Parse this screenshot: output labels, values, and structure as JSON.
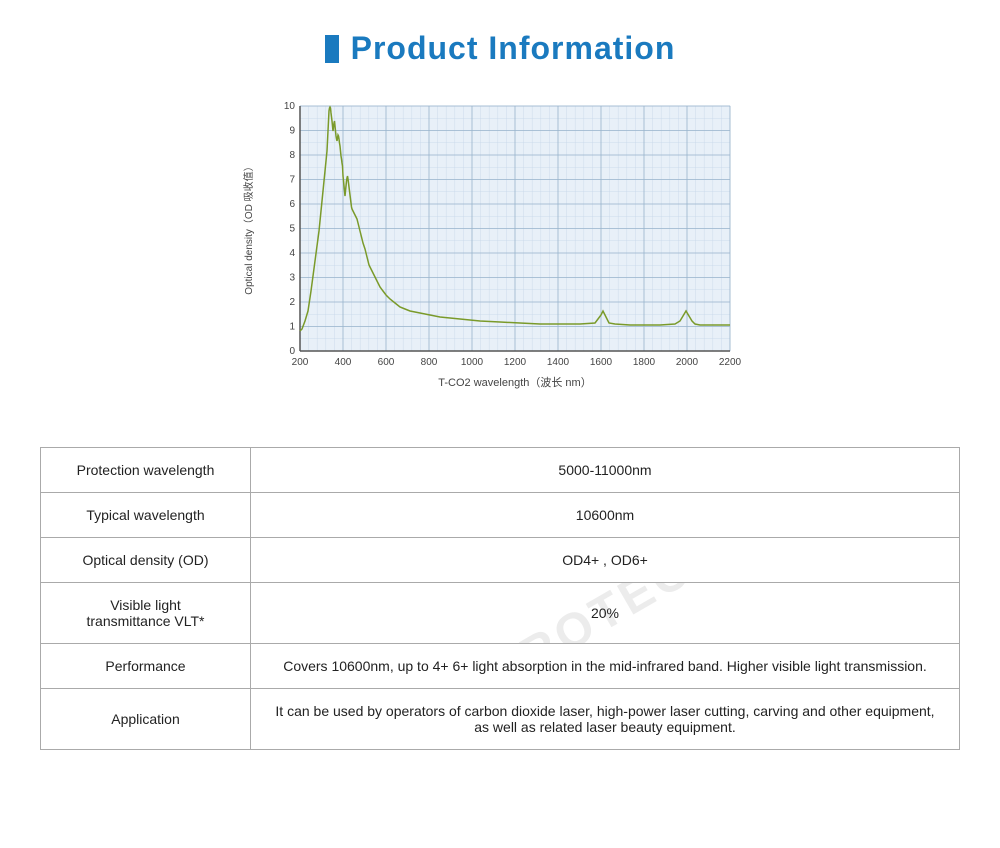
{
  "header": {
    "title": "Product Information",
    "title_square_color": "#1a7abf"
  },
  "chart": {
    "y_label": "Optical density（OD 吸收值）",
    "x_label": "T-CO2 wavelength（波长 nm）",
    "y_ticks": [
      0,
      1,
      2,
      3,
      4,
      5,
      6,
      7,
      8,
      9,
      10
    ],
    "x_ticks": [
      200,
      400,
      600,
      800,
      1000,
      1200,
      1400,
      1600,
      1800,
      2000,
      2200
    ]
  },
  "table": {
    "rows": [
      {
        "label": "Protection wavelength",
        "value": "5000-11000nm"
      },
      {
        "label": "Typical wavelength",
        "value": "10600nm"
      },
      {
        "label": "Optical density (OD)",
        "value": "OD4+ , OD6+"
      },
      {
        "label": "Visible light\ntransmittance VLT*",
        "value": "20%",
        "has_watermark": true
      },
      {
        "label": "Performance",
        "value": "Covers 10600nm, up to 4+ 6+ light absorption in the mid-infrared band. Higher visible light transmission."
      },
      {
        "label": "Application",
        "value": "It can be used by operators of carbon dioxide laser, high-power laser cutting, carving and other equipment, as well as related laser beauty equipment."
      }
    ]
  }
}
